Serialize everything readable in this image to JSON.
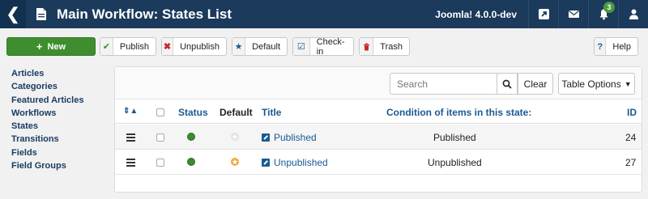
{
  "header": {
    "title": "Main Workflow: States List",
    "version": "Joomla! 4.0.0-dev",
    "notifications_count": "3"
  },
  "toolbar": {
    "new_label": "New",
    "publish_label": "Publish",
    "unpublish_label": "Unpublish",
    "default_label": "Default",
    "checkin_label": "Check-in",
    "trash_label": "Trash",
    "help_label": "Help",
    "help_icon_text": "?"
  },
  "sidebar": {
    "items": [
      {
        "label": "Articles"
      },
      {
        "label": "Categories"
      },
      {
        "label": "Featured Articles"
      },
      {
        "label": "Workflows"
      },
      {
        "label": "States"
      },
      {
        "label": "Transitions"
      },
      {
        "label": "Fields"
      },
      {
        "label": "Field Groups"
      }
    ]
  },
  "filters": {
    "search_placeholder": "Search",
    "clear_label": "Clear",
    "options_label": "Table Options"
  },
  "table": {
    "headers": {
      "status": "Status",
      "default": "Default",
      "title": "Title",
      "condition": "Condition of items in this state:",
      "id": "ID"
    },
    "rows": [
      {
        "title": "Published",
        "condition": "Published",
        "id": "24",
        "is_default": true
      },
      {
        "title": "Unpublished",
        "condition": "Unpublished",
        "id": "27",
        "is_default": false
      }
    ]
  },
  "colors": {
    "header_bg": "#1b3a5c",
    "new_button": "#3e8e2f",
    "link": "#1a5a93",
    "default_star": "#e58a1f"
  }
}
